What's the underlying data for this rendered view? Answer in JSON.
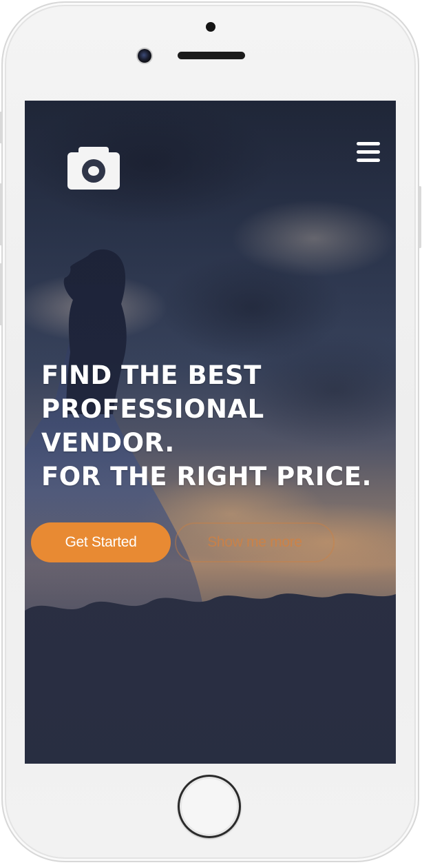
{
  "hero": {
    "headline_lines": [
      "FIND THE BEST",
      "PROFESSIONAL",
      "VENDOR.",
      "FOR THE RIGHT PRICE."
    ]
  },
  "actions": {
    "primary_label": "Get Started",
    "secondary_label": "Show me more"
  },
  "icons": {
    "logo": "camera-icon",
    "menu": "hamburger-menu-icon"
  },
  "colors": {
    "accent": "#e88a33",
    "text": "#ffffff",
    "background": "#2f3548"
  }
}
